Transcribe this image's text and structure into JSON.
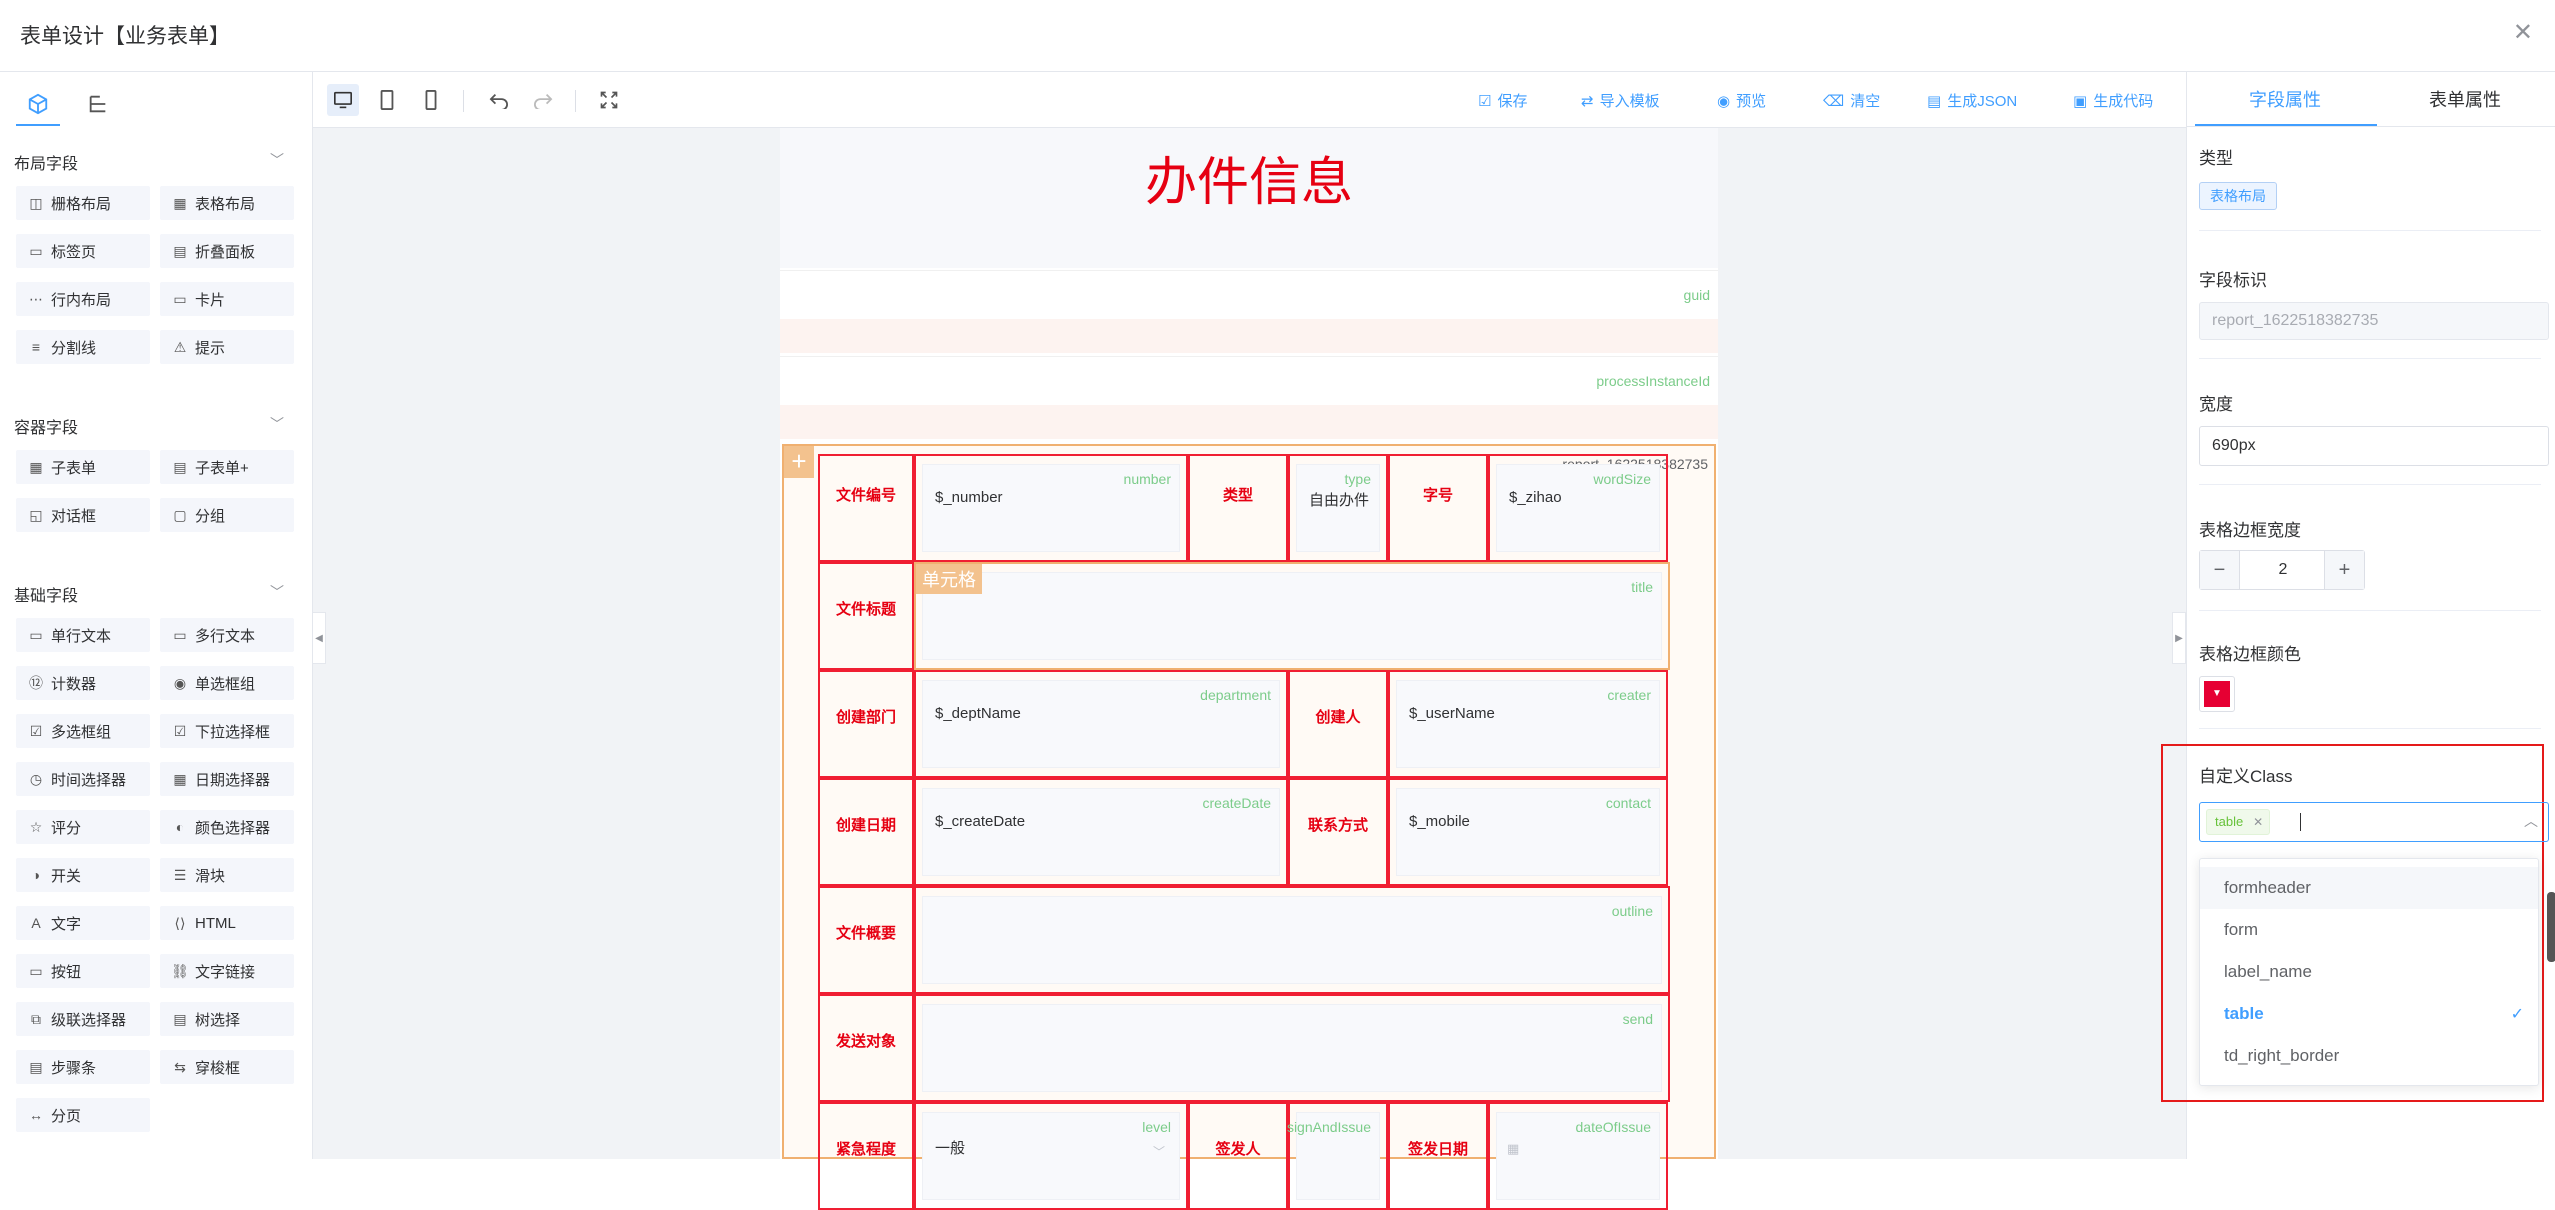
{
  "window": {
    "title": "表单设计【业务表单】",
    "close_icon": "close-icon"
  },
  "left_panel": {
    "sections": [
      {
        "title": "布局字段",
        "items": [
          "栅格布局",
          "表格布局",
          "标签页",
          "折叠面板",
          "行内布局",
          "卡片",
          "分割线",
          "提示"
        ]
      },
      {
        "title": "容器字段",
        "items": [
          "子表单",
          "子表单+",
          "对话框",
          "分组"
        ]
      },
      {
        "title": "基础字段",
        "items": [
          "单行文本",
          "多行文本",
          "计数器",
          "单选框组",
          "多选框组",
          "下拉选择框",
          "时间选择器",
          "日期选择器",
          "评分",
          "颜色选择器",
          "开关",
          "滑块",
          "文字",
          "HTML",
          "按钮",
          "文字链接",
          "级联选择器",
          "树选择",
          "步骤条",
          "穿梭框",
          "分页"
        ]
      }
    ]
  },
  "toolbar": {
    "actions": [
      "保存",
      "导入模板",
      "预览",
      "清空",
      "生成JSON",
      "生成代码"
    ]
  },
  "form": {
    "heading": "办件信息",
    "hidden_fields": [
      "guid",
      "processInstanceId"
    ],
    "table_id": "report_1622518382735",
    "cell_tag": "单元格",
    "rows": [
      {
        "label": "文件编号",
        "value": "$_number",
        "field": "number",
        "label2": "类型",
        "value2": "自由办件",
        "field2": "type",
        "label3": "字号",
        "value3": "$_zihao",
        "field3": "wordSize"
      },
      {
        "label": "文件标题",
        "value": "",
        "field": "title"
      },
      {
        "label": "创建部门",
        "value": "$_deptName",
        "field": "department",
        "label2": "创建人",
        "value2": "$_userName",
        "field2": "creater"
      },
      {
        "label": "创建日期",
        "value": "$_createDate",
        "field": "createDate",
        "label2": "联系方式",
        "value2": "$_mobile",
        "field2": "contact"
      },
      {
        "label": "文件概要",
        "value": "",
        "field": "outline"
      },
      {
        "label": "发送对象",
        "value": "",
        "field": "send"
      },
      {
        "label": "紧急程度",
        "value": "一般",
        "field": "level",
        "label2": "签发人",
        "value2": "",
        "field2": "signAndIssue",
        "label3": "签发日期",
        "value3": "",
        "field3": "dateOfIssue"
      }
    ]
  },
  "right_panel": {
    "tabs": [
      "字段属性",
      "表单属性"
    ],
    "type_label": "类型",
    "type_value": "表格布局",
    "field_id_label": "字段标识",
    "field_id_value": "report_1622518382735",
    "width_label": "宽度",
    "width_value": "690px",
    "border_width_label": "表格边框宽度",
    "border_width_value": "2",
    "border_color_label": "表格边框颜色",
    "border_color": "#f01e32",
    "class_label": "自定义Class",
    "class_tag": "table",
    "dropdown_options": [
      "formheader",
      "form",
      "label_name",
      "table",
      "td_right_border"
    ],
    "selected_option": "table"
  },
  "colors": {
    "accent": "#409eff",
    "border_red": "#f01e32",
    "label_red": "#e60012",
    "field_green": "#7ccc8a",
    "highlight_orange": "#f0c080"
  }
}
